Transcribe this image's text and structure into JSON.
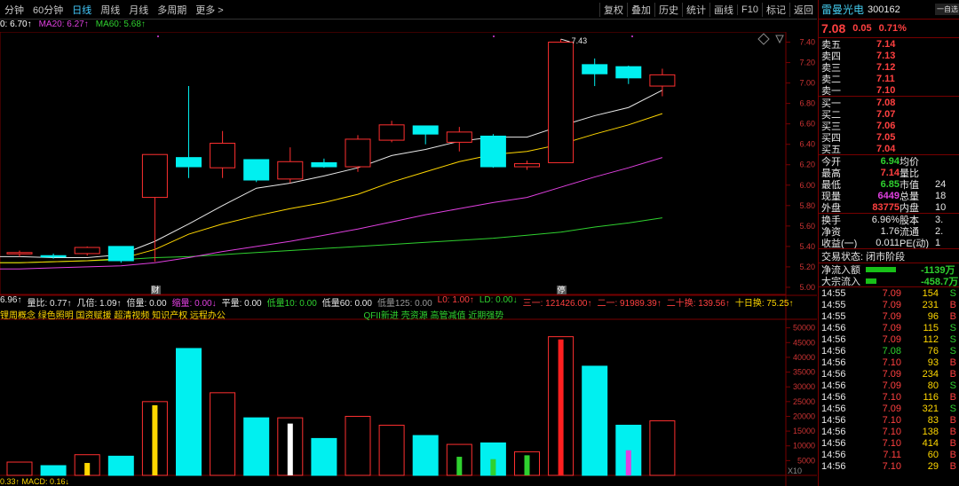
{
  "toolbar": {
    "periods": [
      "分钟",
      "60分钟",
      "日线",
      "周线",
      "月线",
      "多周期",
      "更多 >"
    ],
    "active_period": "日线",
    "buttons": [
      "复权",
      "叠加",
      "历史",
      "统计",
      "画线",
      "F10",
      "标记",
      "返回"
    ]
  },
  "ma_legend": [
    {
      "text": "0: 6.70↑",
      "color": "#ffffff"
    },
    {
      "text": "MA20: 6.27↑",
      "color": "#e040e0"
    },
    {
      "text": "MA60: 5.68↑",
      "color": "#2fd12f"
    }
  ],
  "price_axis": [
    "7.40",
    "7.20",
    "7.00",
    "6.80",
    "6.60",
    "6.40",
    "6.20",
    "6.00",
    "5.80",
    "5.60",
    "5.40",
    "5.20",
    "5.00"
  ],
  "vol_axis": [
    "50000",
    "45000",
    "40000",
    "35000",
    "30000",
    "25000",
    "20000",
    "15000",
    "10000",
    "5000"
  ],
  "vol_axis_unit": "X10",
  "high_label": "7.43",
  "marks": {
    "cai": "财",
    "ting": "停"
  },
  "vol_legend": [
    {
      "text": "6.96↑",
      "color": "#e8e8e8"
    },
    {
      "text": "量比: 0.77↑",
      "color": "#e8e8e8"
    },
    {
      "text": "几倍: 1.09↑",
      "color": "#e8e8e8"
    },
    {
      "text": "倍量: 0.00",
      "color": "#e8e8e8"
    },
    {
      "text": "缩量: 0.00↓",
      "color": "#e040e0"
    },
    {
      "text": "平量: 0.00",
      "color": "#e8e8e8"
    },
    {
      "text": "低量10: 0.00",
      "color": "#2fd12f"
    },
    {
      "text": "低量60: 0.00",
      "color": "#e8e8e8"
    },
    {
      "text": "低量125: 0.00",
      "color": "#999999"
    },
    {
      "text": "L0: 1.00↑",
      "color": "#ff4040"
    },
    {
      "text": "LD: 0.00↓",
      "color": "#2fd12f"
    },
    {
      "text": "三一: 121426.00↑",
      "color": "#ff4040"
    },
    {
      "text": "二一: 91989.39↑",
      "color": "#ff4040"
    },
    {
      "text": "二十换: 139.56↑",
      "color": "#ff4040"
    },
    {
      "text": "十日换: 75.25↑",
      "color": "#ffd700"
    }
  ],
  "concepts": {
    "left": "锂周概念 绿色照明 国资赋援 超清视频 知识产权 远程办公",
    "right": "QFII新进 壳资源 高管减值 近期强势"
  },
  "macd_text": "0.33↑   MACD: 0.16↓",
  "stock": {
    "name": "雷曼光电",
    "code": "300162",
    "price": "7.08",
    "change": "0.05",
    "pct": "0.71%",
    "corner": "一自选"
  },
  "asks": [
    {
      "label": "卖五",
      "price": "7.14"
    },
    {
      "label": "卖四",
      "price": "7.13"
    },
    {
      "label": "卖三",
      "price": "7.12"
    },
    {
      "label": "卖二",
      "price": "7.11"
    },
    {
      "label": "卖一",
      "price": "7.10"
    }
  ],
  "bids": [
    {
      "label": "买一",
      "price": "7.08"
    },
    {
      "label": "买二",
      "price": "7.07"
    },
    {
      "label": "买三",
      "price": "7.06"
    },
    {
      "label": "买四",
      "price": "7.05"
    },
    {
      "label": "买五",
      "price": "7.04"
    }
  ],
  "stats": [
    {
      "l1": "今开",
      "v1": "6.94",
      "c1": "green",
      "l2": "均价",
      "v2": ""
    },
    {
      "l1": "最高",
      "v1": "7.14",
      "c1": "red",
      "l2": "量比",
      "v2": ""
    },
    {
      "l1": "最低",
      "v1": "6.85",
      "c1": "green",
      "l2": "市值",
      "v2": "24"
    },
    {
      "l1": "现量",
      "v1": "6449",
      "c1": "magenta",
      "l2": "总量",
      "v2": "18"
    },
    {
      "l1": "外盘",
      "v1": "83775",
      "c1": "red",
      "l2": "内盘",
      "v2": "10"
    }
  ],
  "stats2": [
    {
      "l1": "换手",
      "v1": "6.96%",
      "l2": "股本",
      "v2": "3."
    },
    {
      "l1": "净资",
      "v1": "1.76",
      "l2": "流通",
      "v2": "2."
    },
    {
      "l1": "收益(一)",
      "v1": "0.011",
      "l2": "PE(动)",
      "v2": "1"
    }
  ],
  "trade_status": "交易状态: 闭市阶段",
  "flows": [
    {
      "label": "净流入额",
      "value": "-1139万",
      "fill": 0.55
    },
    {
      "label": "大宗流入",
      "value": "-458.7万",
      "fill": 0.2
    }
  ],
  "ticks": [
    {
      "time": "14:55",
      "price": "7.09",
      "vol": "154",
      "side": "S"
    },
    {
      "time": "14:55",
      "price": "7.09",
      "vol": "231",
      "side": "B"
    },
    {
      "time": "14:55",
      "price": "7.09",
      "vol": "96",
      "side": "B"
    },
    {
      "time": "14:56",
      "price": "7.09",
      "vol": "115",
      "side": "S"
    },
    {
      "time": "14:56",
      "price": "7.09",
      "vol": "112",
      "side": "S"
    },
    {
      "time": "14:56",
      "price": "7.08",
      "vol": "76",
      "side": "S"
    },
    {
      "time": "14:56",
      "price": "7.10",
      "vol": "93",
      "side": "B"
    },
    {
      "time": "14:56",
      "price": "7.09",
      "vol": "234",
      "side": "B"
    },
    {
      "time": "14:56",
      "price": "7.09",
      "vol": "80",
      "side": "S"
    },
    {
      "time": "14:56",
      "price": "7.10",
      "vol": "116",
      "side": "B"
    },
    {
      "time": "14:56",
      "price": "7.09",
      "vol": "321",
      "side": "S"
    },
    {
      "time": "14:56",
      "price": "7.10",
      "vol": "83",
      "side": "B"
    },
    {
      "time": "14:56",
      "price": "7.10",
      "vol": "138",
      "side": "B"
    },
    {
      "time": "14:56",
      "price": "7.10",
      "vol": "414",
      "side": "B"
    },
    {
      "time": "14:56",
      "price": "7.11",
      "vol": "60",
      "side": "B"
    },
    {
      "time": "14:56",
      "price": "7.10",
      "vol": "29",
      "side": "B"
    }
  ],
  "chart_data": {
    "type": "candlestick",
    "candles": [
      {
        "o": 5.34,
        "h": 5.36,
        "l": 5.3,
        "c": 5.33,
        "up": true
      },
      {
        "o": 5.31,
        "h": 5.33,
        "l": 5.28,
        "c": 5.3,
        "up": false
      },
      {
        "o": 5.33,
        "h": 5.4,
        "l": 5.31,
        "c": 5.39,
        "up": true
      },
      {
        "o": 5.4,
        "h": 5.4,
        "l": 5.24,
        "c": 5.26,
        "up": false
      },
      {
        "o": 5.88,
        "h": 6.3,
        "l": 5.25,
        "c": 6.3,
        "up": true
      },
      {
        "o": 6.18,
        "h": 6.97,
        "l": 6.07,
        "c": 6.27,
        "up": false
      },
      {
        "o": 6.17,
        "h": 6.53,
        "l": 6.07,
        "c": 6.41,
        "up": true
      },
      {
        "o": 6.25,
        "h": 6.25,
        "l": 6.03,
        "c": 6.05,
        "up": false
      },
      {
        "o": 6.06,
        "h": 6.37,
        "l": 6.02,
        "c": 6.23,
        "up": true
      },
      {
        "o": 6.22,
        "h": 6.26,
        "l": 6.17,
        "c": 6.18,
        "up": false
      },
      {
        "o": 6.18,
        "h": 6.49,
        "l": 6.13,
        "c": 6.45,
        "up": true
      },
      {
        "o": 6.44,
        "h": 6.63,
        "l": 6.42,
        "c": 6.59,
        "up": true
      },
      {
        "o": 6.58,
        "h": 6.58,
        "l": 6.4,
        "c": 6.5,
        "up": false
      },
      {
        "o": 6.42,
        "h": 6.57,
        "l": 6.33,
        "c": 6.52,
        "up": true
      },
      {
        "o": 6.48,
        "h": 6.5,
        "l": 6.17,
        "c": 6.18,
        "up": false
      },
      {
        "o": 6.18,
        "h": 6.24,
        "l": 6.15,
        "c": 6.21,
        "up": true
      },
      {
        "o": 6.22,
        "h": 7.43,
        "l": 6.22,
        "c": 7.4,
        "up": true
      },
      {
        "o": 7.18,
        "h": 7.24,
        "l": 6.97,
        "c": 7.09,
        "up": false
      },
      {
        "o": 7.16,
        "h": 7.17,
        "l": 6.99,
        "c": 7.05,
        "up": false
      },
      {
        "o": 6.97,
        "h": 7.14,
        "l": 6.87,
        "c": 7.08,
        "up": true
      }
    ],
    "ma_white": [
      5.3,
      5.29,
      5.29,
      5.32,
      5.45,
      5.62,
      5.8,
      5.97,
      6.02,
      6.09,
      6.17,
      6.29,
      6.35,
      6.43,
      6.47,
      6.47,
      6.58,
      6.68,
      6.76,
      6.93
    ],
    "ma_yellow": [
      5.24,
      5.25,
      5.26,
      5.28,
      5.37,
      5.52,
      5.62,
      5.7,
      5.77,
      5.83,
      5.91,
      6.03,
      6.13,
      6.23,
      6.3,
      6.33,
      6.4,
      6.5,
      6.59,
      6.7
    ],
    "ma20": [
      5.18,
      5.19,
      5.2,
      5.21,
      5.24,
      5.29,
      5.35,
      5.4,
      5.45,
      5.51,
      5.57,
      5.64,
      5.71,
      5.77,
      5.83,
      5.88,
      5.98,
      6.08,
      6.17,
      6.27
    ],
    "ma60": [
      5.24,
      5.25,
      5.26,
      5.27,
      5.29,
      5.3,
      5.32,
      5.34,
      5.36,
      5.38,
      5.4,
      5.42,
      5.44,
      5.46,
      5.48,
      5.51,
      5.54,
      5.59,
      5.63,
      5.68
    ],
    "volumes": [
      4500,
      3300,
      7000,
      6500,
      25000,
      43000,
      28000,
      19500,
      19500,
      12500,
      20000,
      17000,
      13500,
      10500,
      11000,
      8000,
      47000,
      37000,
      17000,
      18500
    ],
    "vol_up": [
      true,
      false,
      true,
      false,
      true,
      false,
      true,
      false,
      true,
      false,
      true,
      true,
      false,
      true,
      false,
      true,
      true,
      false,
      false,
      true
    ],
    "ylim": [
      4.93,
      7.5
    ],
    "vol_ylim": [
      0,
      52000
    ]
  }
}
